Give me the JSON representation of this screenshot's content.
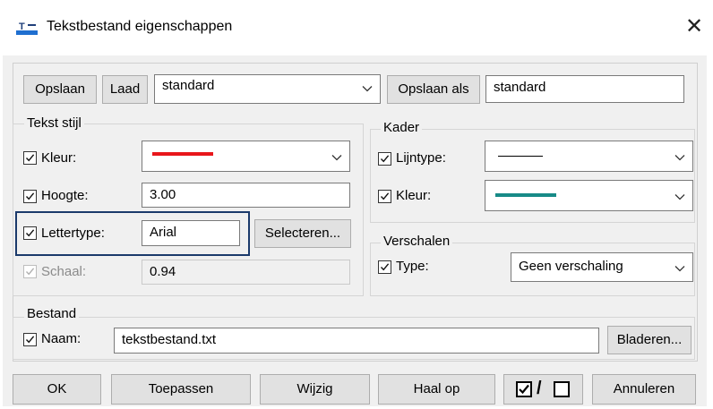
{
  "window": {
    "title": "Tekstbestand eigenschappen",
    "app_icon": "text-file-app-icon",
    "close_glyph": "✕"
  },
  "preset_bar": {
    "save_label": "Opslaan",
    "load_label": "Laad",
    "preset_selected": "standard",
    "save_as_label": "Opslaan als",
    "save_as_value": "standard"
  },
  "text_style": {
    "title": "Tekst stijl",
    "color_label": "Kleur:",
    "color_checked": true,
    "color_value": "#e8161b",
    "height_label": "Hoogte:",
    "height_checked": true,
    "height_value": "3.00",
    "font_label": "Lettertype:",
    "font_checked": true,
    "font_value": "Arial",
    "select_label": "Selecteren...",
    "scale_label": "Schaal:",
    "scale_checked": true,
    "scale_disabled": true,
    "scale_value": "0.94"
  },
  "frame": {
    "title": "Kader",
    "linetype_label": "Lijntype:",
    "linetype_checked": true,
    "linetype_line_color": "#000000",
    "color_label": "Kleur:",
    "color_checked": true,
    "color_value": "#178a87"
  },
  "scaling": {
    "title": "Verschalen",
    "type_label": "Type:",
    "type_checked": true,
    "type_value": "Geen verschaling"
  },
  "file": {
    "title": "Bestand",
    "name_label": "Naam:",
    "name_checked": true,
    "name_value": "tekstbestand.txt",
    "browse_label": "Bladeren..."
  },
  "footer": {
    "ok_label": "OK",
    "apply_label": "Toepassen",
    "modify_label": "Wijzig",
    "fetch_label": "Haal op",
    "toggle_separator": "/",
    "cancel_label": "Annuleren"
  },
  "colors": {
    "focus_border": "#1b3a6b",
    "dialog_bg": "#f0f0f0"
  }
}
